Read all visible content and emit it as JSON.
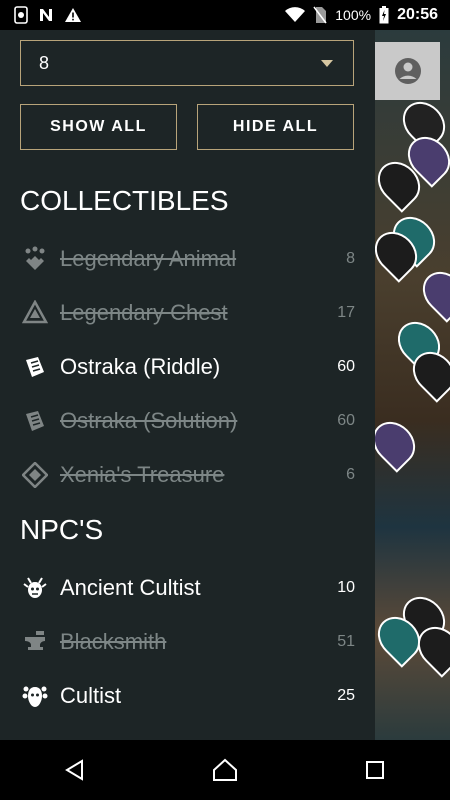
{
  "status_bar": {
    "battery": "100%",
    "time": "20:56",
    "icons": [
      "sim-icon",
      "n-icon",
      "warning-icon",
      "wifi-icon",
      "no-sim-icon",
      "battery-charging-icon"
    ]
  },
  "filter": {
    "selected": "8"
  },
  "buttons": {
    "show_all": "SHOW ALL",
    "hide_all": "HIDE ALL"
  },
  "sections": {
    "collectibles": {
      "title": "COLLECTIBLES",
      "items": [
        {
          "label": "Legendary Animal",
          "count": "8",
          "enabled": false,
          "icon": "paw-icon"
        },
        {
          "label": "Legendary Chest",
          "count": "17",
          "enabled": false,
          "icon": "chest-icon"
        },
        {
          "label": "Ostraka (Riddle)",
          "count": "60",
          "enabled": true,
          "icon": "scroll-icon"
        },
        {
          "label": "Ostraka (Solution)",
          "count": "60",
          "enabled": false,
          "icon": "scroll-icon"
        },
        {
          "label": "Xenia's Treasure",
          "count": "6",
          "enabled": false,
          "icon": "treasure-icon"
        }
      ]
    },
    "npcs": {
      "title": "NPC'S",
      "items": [
        {
          "label": "Ancient Cultist",
          "count": "10",
          "enabled": true,
          "icon": "ancient-cultist-icon"
        },
        {
          "label": "Blacksmith",
          "count": "51",
          "enabled": false,
          "icon": "anvil-icon"
        },
        {
          "label": "Cultist",
          "count": "25",
          "enabled": true,
          "icon": "cultist-mask-icon"
        }
      ]
    }
  },
  "colors": {
    "drawer_bg": "#1d2526",
    "accent_border": "#b8a47a",
    "disabled_text": "#7d8686"
  }
}
